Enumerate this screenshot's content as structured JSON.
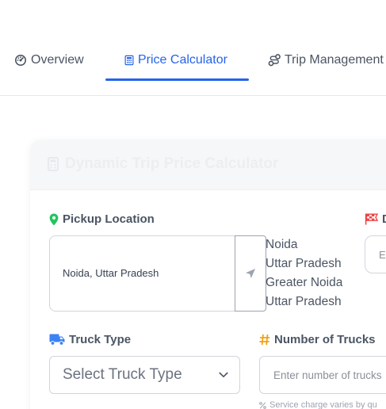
{
  "tabs": [
    {
      "label": "Overview",
      "icon": "gauge-icon",
      "active": false
    },
    {
      "label": "Price Calculator",
      "icon": "calculator-icon",
      "active": true
    },
    {
      "label": "Trip Management",
      "icon": "route-icon",
      "active": false
    }
  ],
  "card": {
    "title": "Dynamic Trip Price Calculator",
    "title_icon": "calculator-icon"
  },
  "pickup": {
    "label": "Pickup Location",
    "icon": "map-pin-icon",
    "value": "Noida, Uttar Pradesh",
    "locate_icon": "location-arrow-icon",
    "suggestions": [
      "Noida",
      "Uttar Pradesh",
      "Greater Noida",
      "Uttar Pradesh"
    ]
  },
  "drop": {
    "label_initial": "D",
    "icon": "flag-checkered-icon",
    "placeholder_initial": "E"
  },
  "truck_type": {
    "label": "Truck Type",
    "icon": "truck-icon",
    "selected": "Select Truck Type"
  },
  "num_trucks": {
    "label": "Number of Trucks",
    "icon": "hash-icon",
    "placeholder": "Enter number of trucks",
    "helper": "Service charge varies by qu",
    "helper_icon": "percent-icon"
  },
  "colors": {
    "accent": "#2563eb",
    "pin": "#22c55e",
    "flag": "#ef4444",
    "truck": "#3b82f6",
    "hash": "#f59e0b"
  }
}
